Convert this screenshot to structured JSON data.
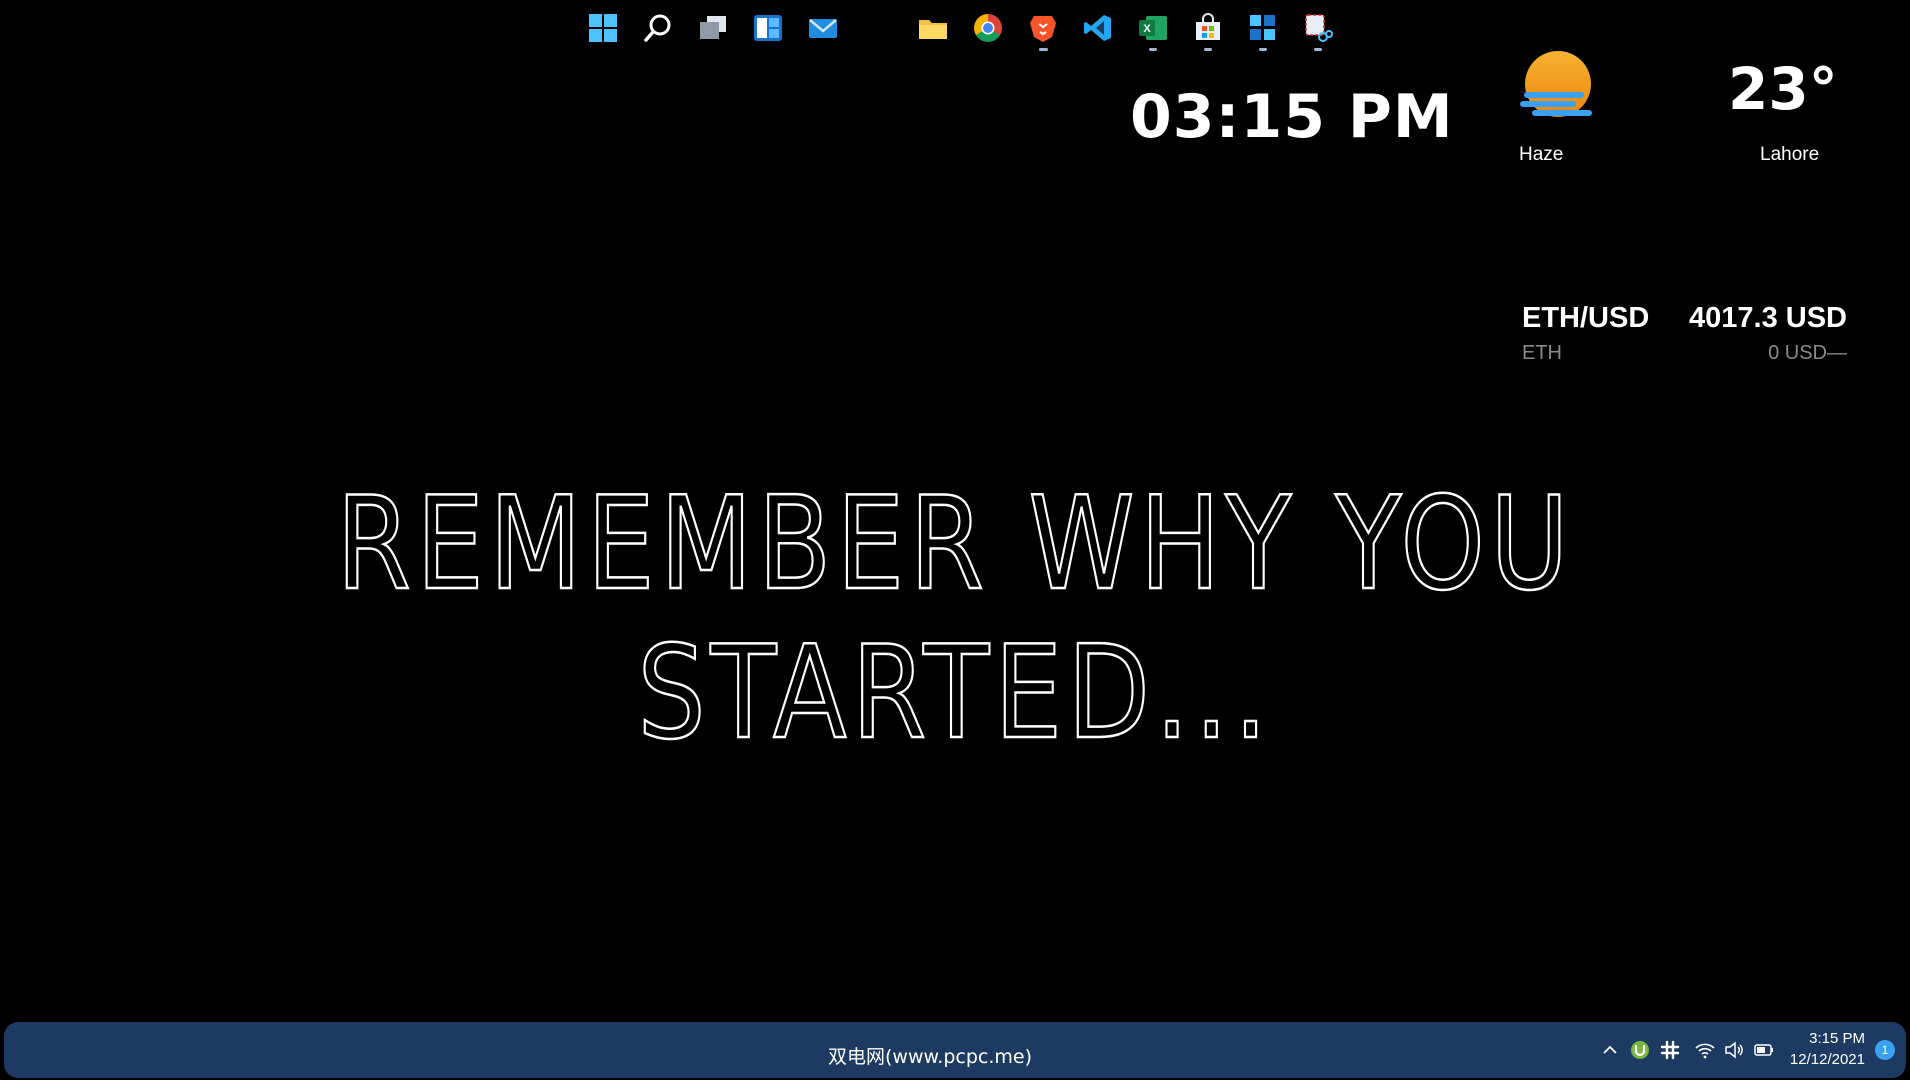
{
  "widgets": {
    "clock": {
      "time": "03:15 PM"
    },
    "weather": {
      "condition": "Haze",
      "temperature": "23°",
      "city": "Lahore",
      "icon": "haze-sun-icon"
    },
    "crypto": {
      "pair": "ETH/USD",
      "symbol": "ETH",
      "price": "4017.3 USD",
      "change": "0 USD—"
    }
  },
  "wallpaper": {
    "quote": "REMEMBER WHY YOU STARTED..."
  },
  "taskbar": {
    "watermark": "双电网(www.pcpc.me)",
    "icons": [
      "windows-start-icon",
      "search-icon",
      "task-view-icon",
      "widgets-icon",
      "mail-icon",
      "file-explorer-icon",
      "chrome-icon",
      "brave-icon",
      "vscode-icon",
      "excel-icon",
      "microsoft-store-icon",
      "start-menu-icon",
      "snipping-tool-icon"
    ],
    "tray": [
      "chevron-up-icon",
      "utorrent-icon",
      "slack-icon",
      "wifi-icon",
      "volume-icon",
      "battery-icon"
    ],
    "clock": {
      "time": "3:15 PM",
      "date": "12/12/2021"
    },
    "notification_count": "1"
  },
  "colors": {
    "background": "#000000",
    "taskbar": "#1d3a63",
    "accent": "#3aa0f0",
    "sun": "#f6a623"
  }
}
